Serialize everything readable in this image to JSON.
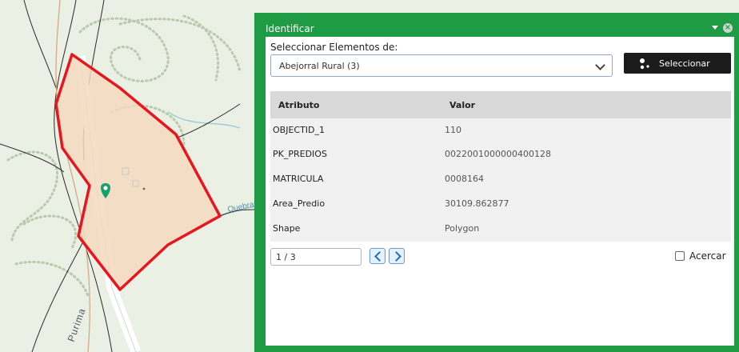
{
  "map": {
    "road_label": "Purima",
    "stream_label": "Quebrada"
  },
  "panel": {
    "title": "Identificar",
    "close_glyph": "×"
  },
  "select": {
    "label": "Seleccionar Elementos de:",
    "value": "Abejorral Rural (3)"
  },
  "button": {
    "label": "Seleccionar"
  },
  "table": {
    "headers": {
      "attr": "Atributo",
      "value": "Valor"
    },
    "rows": [
      {
        "attr": "OBJECTID_1",
        "value": "110"
      },
      {
        "attr": "PK_PREDIOS",
        "value": "0022001000000400128"
      },
      {
        "attr": "MATRICULA",
        "value": "0008164"
      },
      {
        "attr": "Area_Predio",
        "value": "30109.862877"
      },
      {
        "attr": "Shape",
        "value": "Polygon"
      }
    ]
  },
  "pager": {
    "value": "1 / 3"
  },
  "zoom": {
    "label": "Acercar",
    "checked": false
  },
  "colors": {
    "panel_green": "#1f9a45",
    "polygon_stroke": "#e8151e",
    "polygon_fill": "#f4d9bf",
    "marker": "#14a06a"
  },
  "icons": [
    "map-marker-icon",
    "select-features-icon",
    "chevron-down-icon",
    "chevron-left-icon",
    "chevron-right-icon",
    "close-icon",
    "collapse-arrow-icon"
  ]
}
